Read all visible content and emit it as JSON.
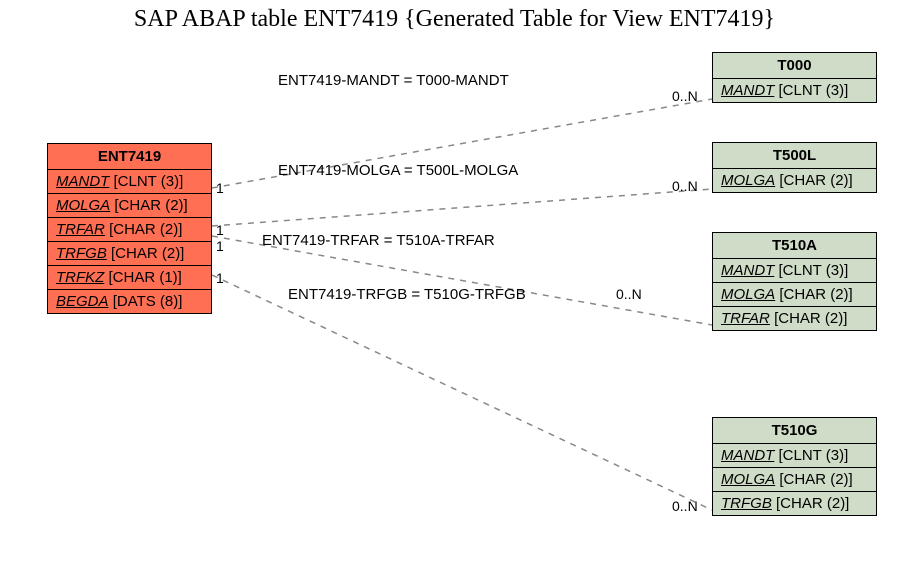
{
  "title": "SAP ABAP table ENT7419 {Generated Table for View ENT7419}",
  "mainEntity": {
    "name": "ENT7419",
    "fields": {
      "f0": {
        "name": "MANDT",
        "type": "[CLNT (3)]"
      },
      "f1": {
        "name": "MOLGA",
        "type": "[CHAR (2)]"
      },
      "f2": {
        "name": "TRFAR",
        "type": "[CHAR (2)]"
      },
      "f3": {
        "name": "TRFGB",
        "type": "[CHAR (2)]"
      },
      "f4": {
        "name": "TRFKZ",
        "type": "[CHAR (1)]"
      },
      "f5": {
        "name": "BEGDA",
        "type": "[DATS (8)]"
      }
    }
  },
  "relEntities": {
    "t000": {
      "name": "T000",
      "fields": {
        "f0": {
          "name": "MANDT",
          "type": "[CLNT (3)]"
        }
      }
    },
    "t500l": {
      "name": "T500L",
      "fields": {
        "f0": {
          "name": "MOLGA",
          "type": "[CHAR (2)]"
        }
      }
    },
    "t510a": {
      "name": "T510A",
      "fields": {
        "f0": {
          "name": "MANDT",
          "type": "[CLNT (3)]"
        },
        "f1": {
          "name": "MOLGA",
          "type": "[CHAR (2)]"
        },
        "f2": {
          "name": "TRFAR",
          "type": "[CHAR (2)]"
        }
      }
    },
    "t510g": {
      "name": "T510G",
      "fields": {
        "f0": {
          "name": "MANDT",
          "type": "[CLNT (3)]"
        },
        "f1": {
          "name": "MOLGA",
          "type": "[CHAR (2)]"
        },
        "f2": {
          "name": "TRFGB",
          "type": "[CHAR (2)]"
        }
      }
    }
  },
  "relations": {
    "r0": {
      "label": "ENT7419-MANDT = T000-MANDT",
      "leftCard": "1",
      "rightCard": "0..N"
    },
    "r1": {
      "label": "ENT7419-MOLGA = T500L-MOLGA",
      "leftCard": "1",
      "rightCard": "0..N"
    },
    "r2": {
      "label": "ENT7419-TRFAR = T510A-TRFAR",
      "leftCard": "1",
      "rightCard": "0..N"
    },
    "r3": {
      "label": "ENT7419-TRFGB = T510G-TRFGB",
      "leftCard": "1",
      "rightCard": "0..N"
    }
  }
}
